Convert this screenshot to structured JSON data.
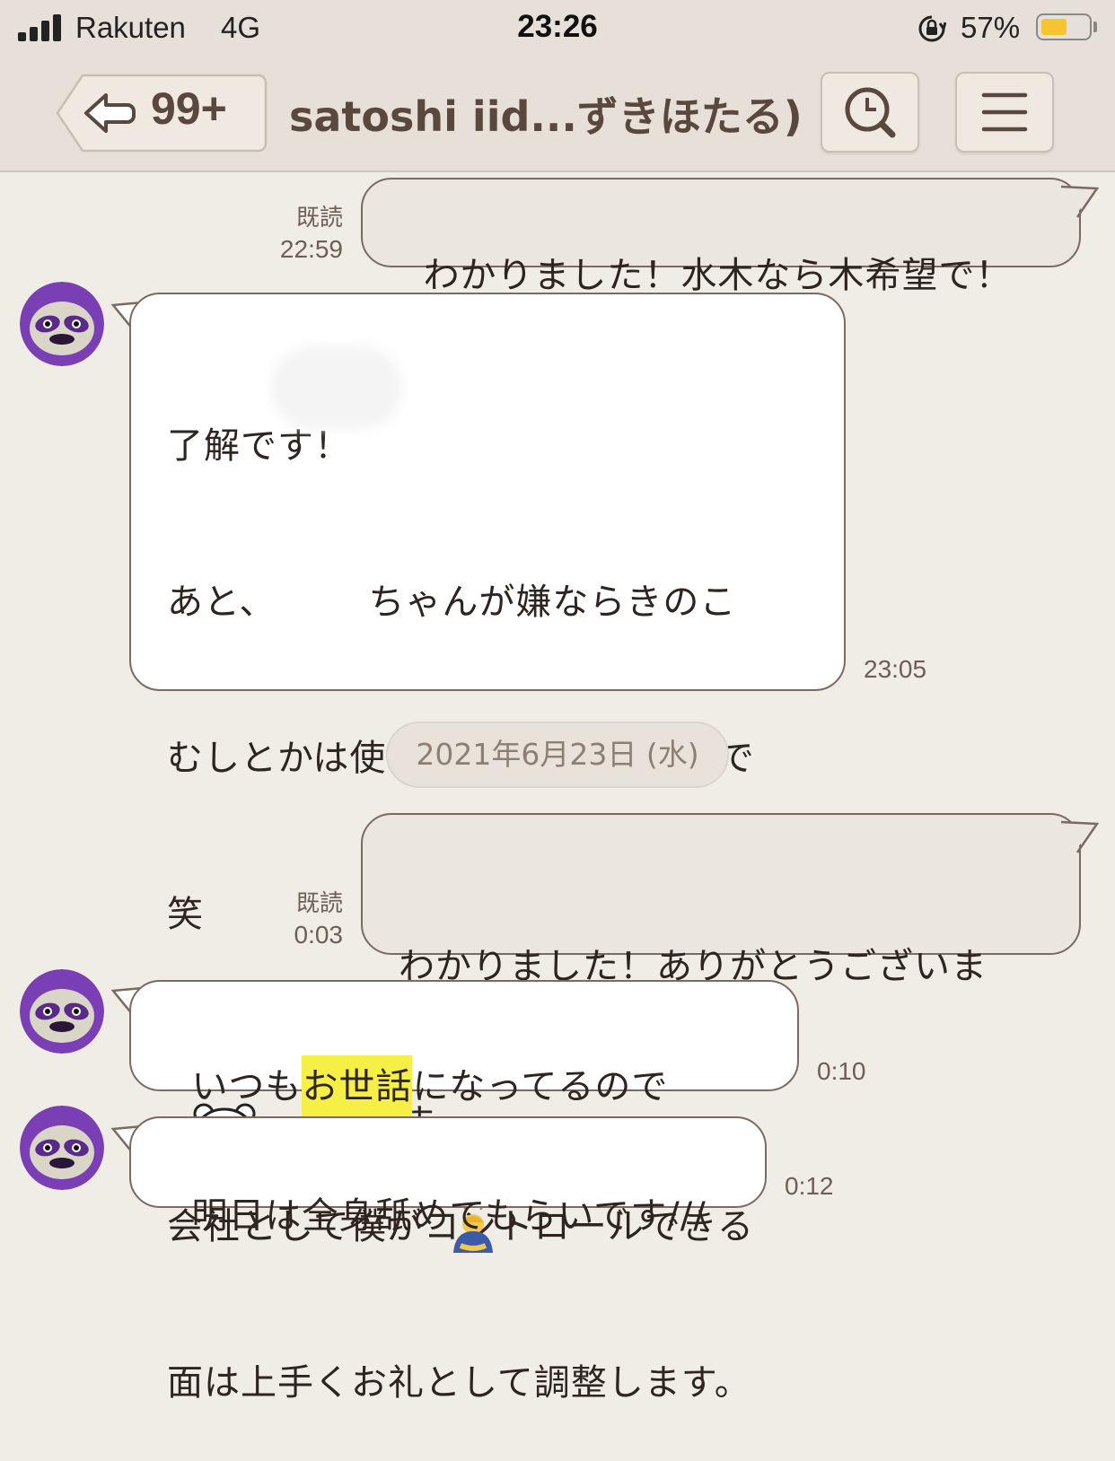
{
  "status_bar": {
    "carrier": "Rakuten",
    "network": "4G",
    "time": "23:26",
    "battery_percent": "57%",
    "battery_level": 0.57,
    "battery_color": "#f5c531"
  },
  "header": {
    "back_count": "99+",
    "title": "satoshi iid...ずきほたる)",
    "search_icon": "magnifier-icon",
    "menu_icon": "hamburger-menu-icon"
  },
  "messages": [
    {
      "direction": "out",
      "read_label": "既読",
      "time": "22:59",
      "text": "わかりました！水木なら木希望で！"
    },
    {
      "direction": "in",
      "time": "23:05",
      "lines": [
        "了解です！",
        "あと、　　　ちゃんが嫌ならきのこ",
        "むしとかは使わない方向にするので",
        "笑",
        "",
        "会社として僕がコントロールできる",
        "面は上手くお礼として調整します。"
      ]
    },
    {
      "direction": "out",
      "read_label": "既読",
      "time": "0:03",
      "lines": [
        "わかりました！ありがとうございま",
        "す"
      ],
      "emoji": "bowing-person-emoji"
    },
    {
      "direction": "in",
      "time": "0:10",
      "text_before": "いつも",
      "highlight": "お世話",
      "text_after": "になってるので",
      "emoji": "bear-face-emoji"
    },
    {
      "direction": "in",
      "time": "0:12",
      "text": "明日は全身舐めてもらいです///"
    }
  ],
  "date_separator": "2021年6月23日 (水)",
  "colors": {
    "background": "#f0ece6",
    "header_bg": "#e7e0d8",
    "outgoing_bubble": "#ebe6df",
    "incoming_bubble": "#ffffff",
    "bubble_border": "#7a6a60",
    "highlight": "#f6ef45",
    "avatar_purple": "#7b3fb5"
  }
}
